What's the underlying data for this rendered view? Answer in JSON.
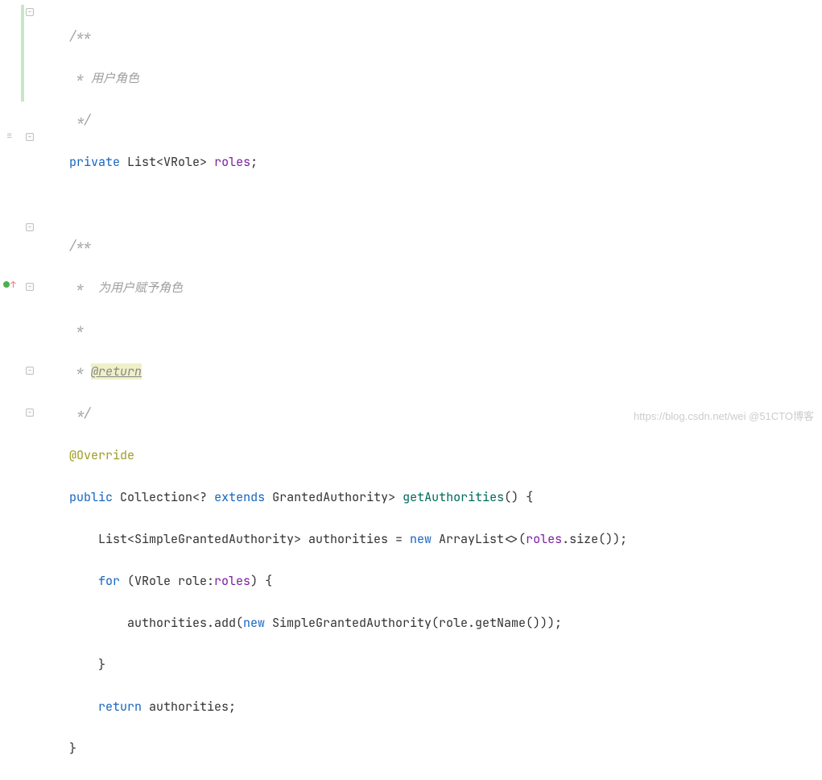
{
  "code": {
    "c1_open": "/**",
    "c1_body": " * 用户角色",
    "c1_close": " */",
    "field_private": "private",
    "field_type": "List<VRole>",
    "field_name": "roles",
    "field_semi": ";",
    "c2_open": "/**",
    "c2_body1": " *  为用户赋予角色",
    "c2_body2": " *",
    "c2_ret_prefix": " * ",
    "c2_ret": "@return",
    "c2_close": " */",
    "anno": "@Override",
    "m_public": "public",
    "m_ret": "Collection<?",
    "m_extends": "extends",
    "m_ret2": "GrantedAuthority>",
    "m_name": "getAuthorities",
    "m_paren": "() {",
    "b1_a": "List<SimpleGrantedAuthority> authorities = ",
    "b1_new": "new",
    "b1_b": " ArrayList<>(",
    "b1_roles": "roles",
    "b1_c": ".size());",
    "b2_for": "for",
    "b2_a": " (VRole role:",
    "b2_roles": "roles",
    "b2_b": ") {",
    "b3_a": "authorities.add(",
    "b3_new": "new",
    "b3_b": " SimpleGrantedAuthority(role.getName()));",
    "b4": "}",
    "b5_ret": "return",
    "b5_a": " authorities;",
    "b6": "}"
  },
  "watermark": "https://blog.csdn.net/wei  @51CTO博客"
}
